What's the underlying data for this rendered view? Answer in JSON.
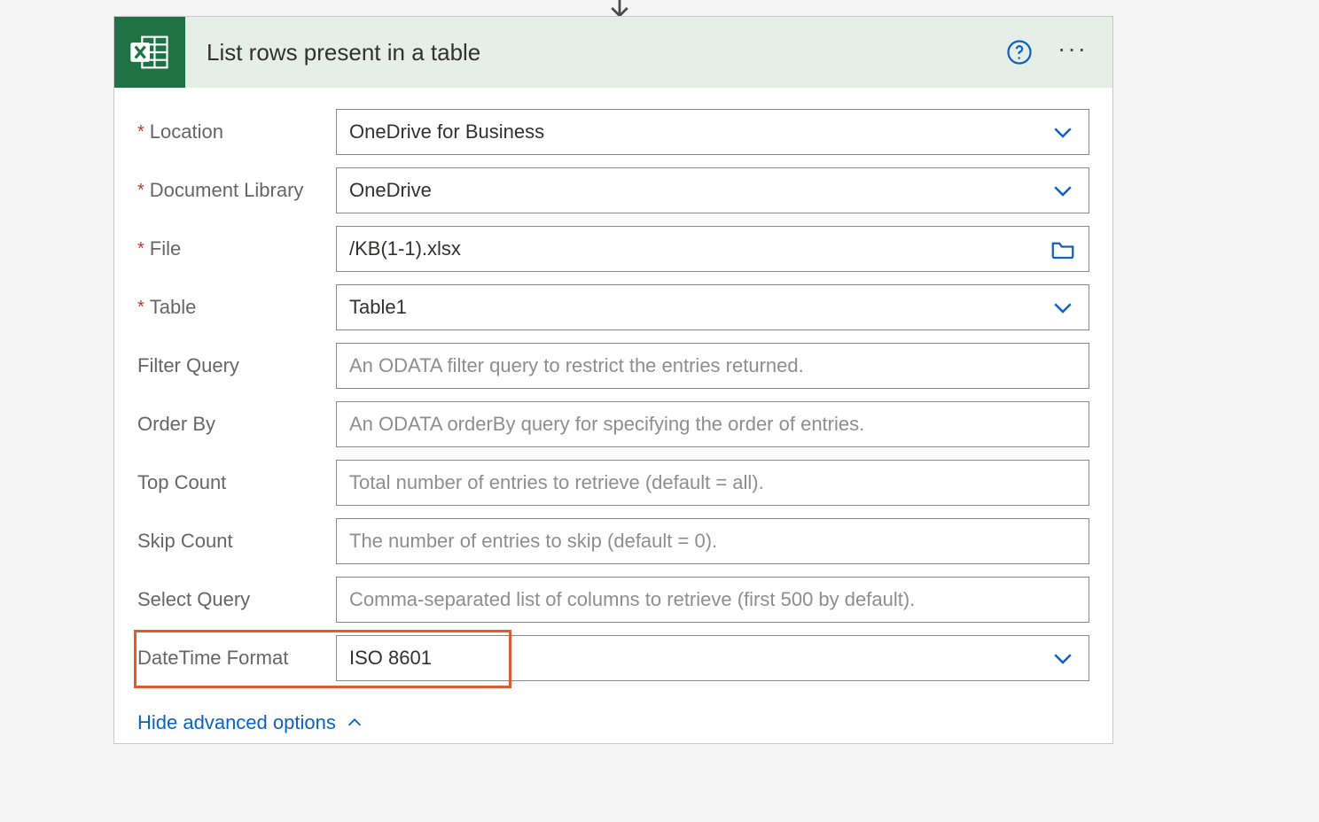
{
  "card": {
    "title": "List rows present in a table",
    "fields": {
      "location": {
        "label": "Location",
        "required": true,
        "value": "OneDrive for Business"
      },
      "doclib": {
        "label": "Document Library",
        "required": true,
        "value": "OneDrive"
      },
      "file": {
        "label": "File",
        "required": true,
        "value": "/KB(1-1).xlsx"
      },
      "table": {
        "label": "Table",
        "required": true,
        "value": "Table1"
      },
      "filter": {
        "label": "Filter Query",
        "required": false,
        "placeholder": "An ODATA filter query to restrict the entries returned."
      },
      "orderby": {
        "label": "Order By",
        "required": false,
        "placeholder": "An ODATA orderBy query for specifying the order of entries."
      },
      "top": {
        "label": "Top Count",
        "required": false,
        "placeholder": "Total number of entries to retrieve (default = all)."
      },
      "skip": {
        "label": "Skip Count",
        "required": false,
        "placeholder": "The number of entries to skip (default = 0)."
      },
      "select": {
        "label": "Select Query",
        "required": false,
        "placeholder": "Comma-separated list of columns to retrieve (first 500 by default)."
      },
      "dtformat": {
        "label": "DateTime Format",
        "required": false,
        "value": "ISO 8601"
      }
    },
    "advanced_toggle": "Hide advanced options"
  }
}
